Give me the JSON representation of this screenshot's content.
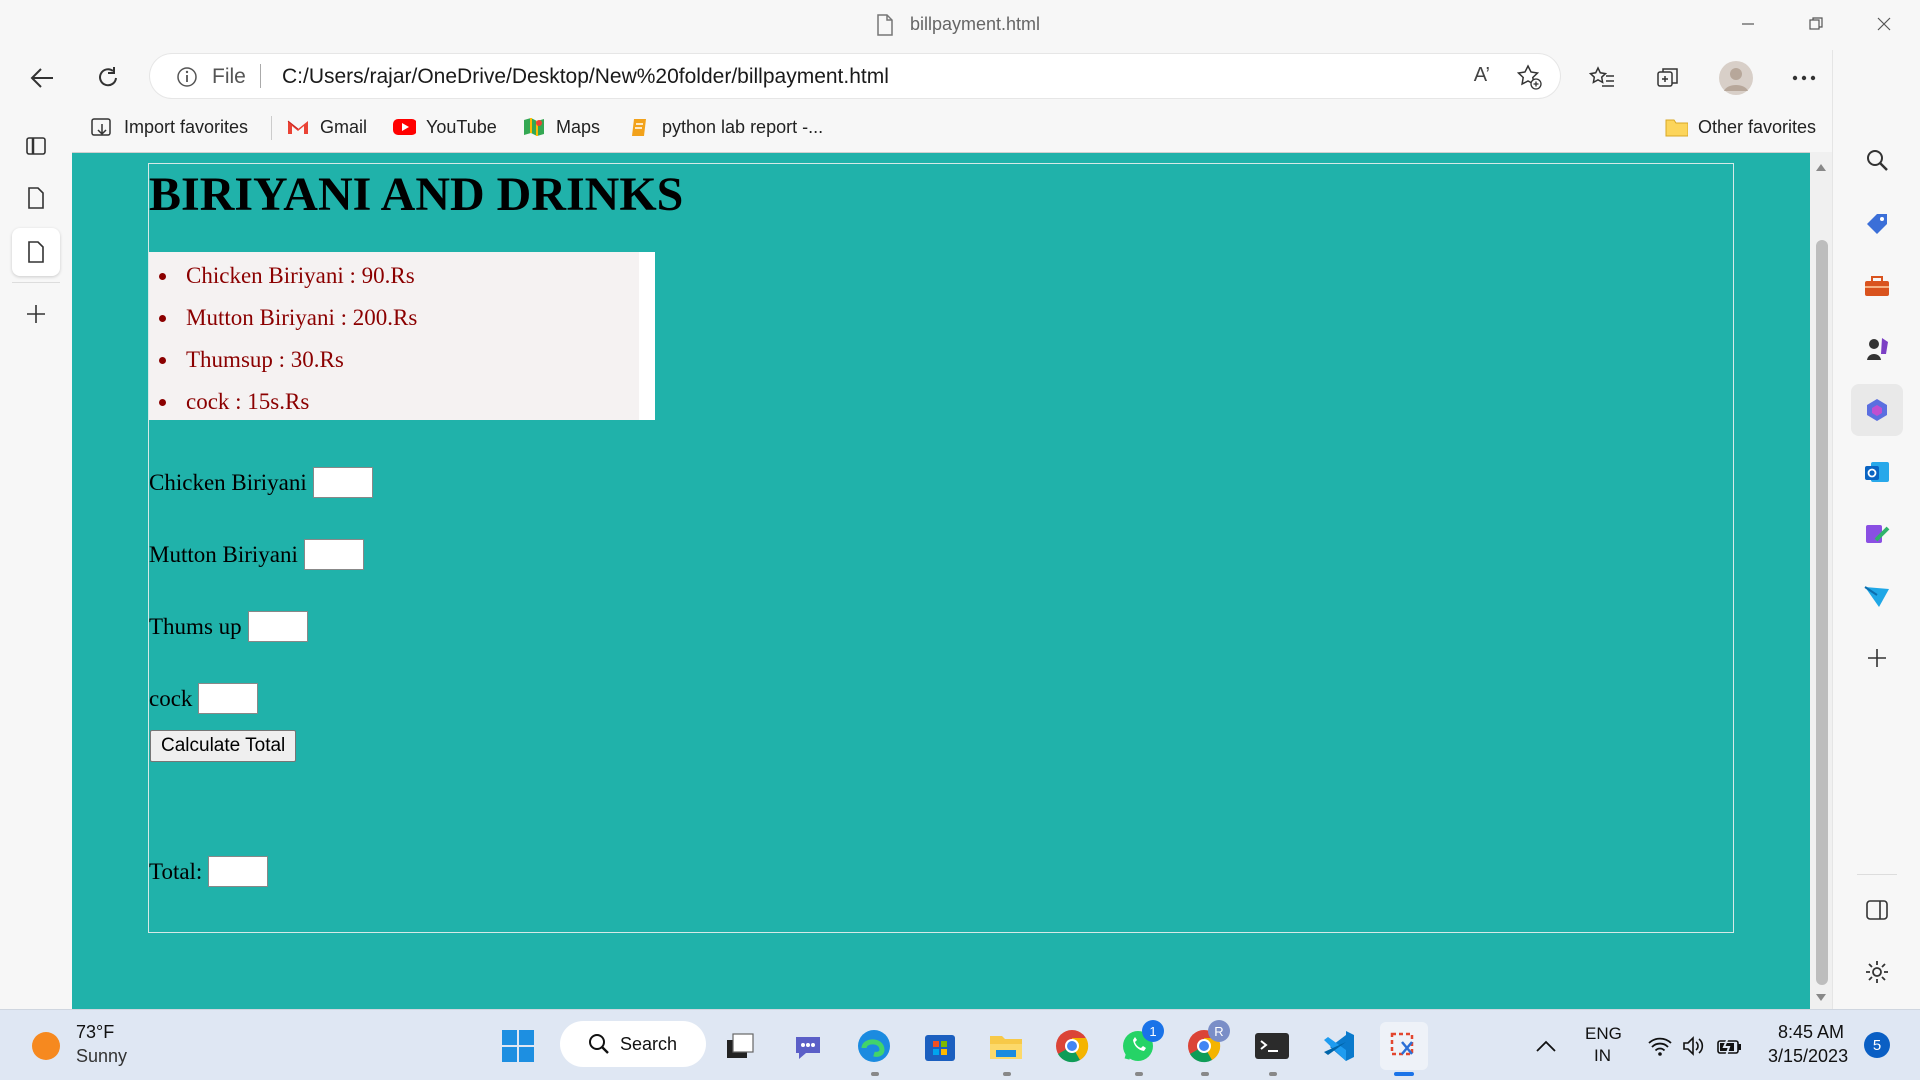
{
  "window": {
    "tab_title": "billpayment.html"
  },
  "address": {
    "scheme_label": "File",
    "url": "C:/Users/rajar/OneDrive/Desktop/New%20folder/billpayment.html",
    "read_aloud": "A’"
  },
  "favorites": {
    "items": [
      {
        "label": "Import favorites",
        "icon": "import-icon"
      },
      {
        "label": "Gmail",
        "icon": "gmail-icon"
      },
      {
        "label": "YouTube",
        "icon": "youtube-icon"
      },
      {
        "label": "Maps",
        "icon": "maps-icon"
      },
      {
        "label": "python lab report -...",
        "icon": "document-icon"
      }
    ],
    "other_label": "Other favorites"
  },
  "page": {
    "heading": "BIRIYANI AND DRINKS",
    "menu_items": [
      "Chicken Biriyani : 90.Rs",
      "Mutton Biriyani : 200.Rs",
      "Thumsup : 30.Rs",
      "cock : 15s.Rs"
    ],
    "fields": {
      "chicken_label": "Chicken Biriyani",
      "chicken_value": "",
      "mutton_label": "Mutton Biriyani",
      "mutton_value": "",
      "thumsup_label": "Thums up",
      "thumsup_value": "",
      "cock_label": "cock",
      "cock_value": ""
    },
    "calculate_button": "Calculate Total",
    "total_label": "Total:",
    "total_value": ""
  },
  "taskbar": {
    "weather_temp": "73°F",
    "weather_condition": "Sunny",
    "search_label": "Search",
    "whatsapp_badge": "1",
    "chrome_profile_badge": "R",
    "lang_primary": "ENG",
    "lang_secondary": "IN",
    "time": "8:45 AM",
    "date": "3/15/2023",
    "notification_count": "5"
  },
  "colors": {
    "page_background": "#20b2aa",
    "menu_text": "#8b0000",
    "menu_background": "#f5f2f2",
    "edge_accent": "#0a5fc4"
  }
}
